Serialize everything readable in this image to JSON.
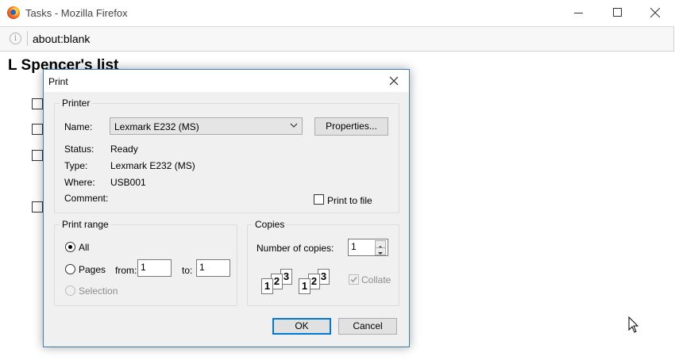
{
  "browser": {
    "window_title": "Tasks - Mozilla Firefox",
    "url": "about:blank"
  },
  "page": {
    "title": "L Spencer's list",
    "task_count": 4
  },
  "print_dialog": {
    "title": "Print",
    "printer": {
      "group_label": "Printer",
      "name_label": "Name:",
      "name_value": "Lexmark E232 (MS)",
      "properties_label": "Properties...",
      "status_label": "Status:",
      "status_value": "Ready",
      "type_label": "Type:",
      "type_value": "Lexmark E232 (MS)",
      "where_label": "Where:",
      "where_value": "USB001",
      "comment_label": "Comment:",
      "print_to_file_label": "Print to file",
      "print_to_file_checked": false
    },
    "print_range": {
      "group_label": "Print range",
      "all_label": "All",
      "pages_label": "Pages",
      "from_label": "from:",
      "from_value": "1",
      "to_label": "to:",
      "to_value": "1",
      "selection_label": "Selection",
      "selected": "All"
    },
    "copies": {
      "group_label": "Copies",
      "number_label": "Number of copies:",
      "number_value": "1",
      "collate_label": "Collate",
      "collate_checked": true,
      "page_numbers": [
        "1",
        "2",
        "3"
      ]
    },
    "ok_label": "OK",
    "cancel_label": "Cancel"
  }
}
